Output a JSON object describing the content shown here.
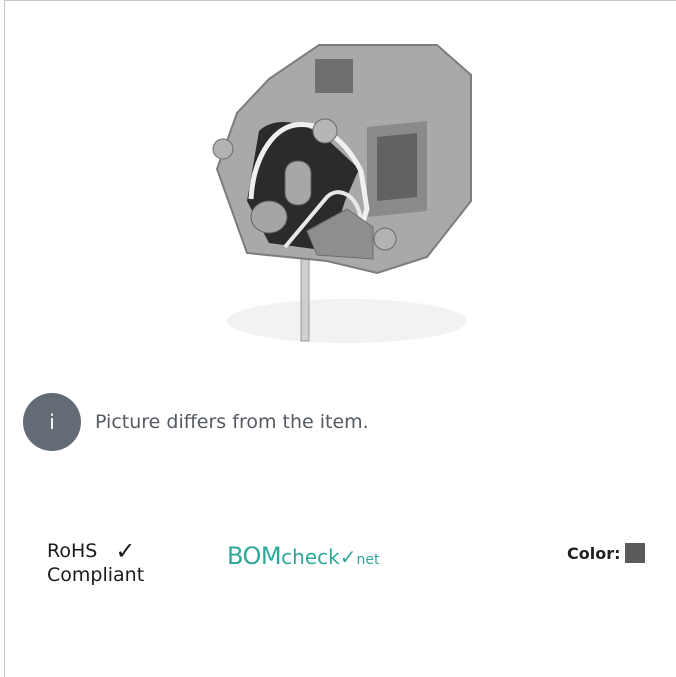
{
  "info": {
    "icon": "info-icon",
    "icon_glyph": "i",
    "message": "Picture differs from the item."
  },
  "badges": {
    "rohs_line1": "RoHS",
    "rohs_check": "✓",
    "rohs_line2": "Compliant",
    "bomcheck_main": "BOM",
    "bomcheck_check": "check",
    "bomcheck_tick": "✓",
    "bomcheck_net": "net"
  },
  "color": {
    "label": "Color:",
    "swatch_hex": "#5a5a5a"
  },
  "product": {
    "body_hex": "#a8a8a8",
    "shade_hex": "#8d8d8d",
    "dark_hex": "#2a2a2a"
  }
}
